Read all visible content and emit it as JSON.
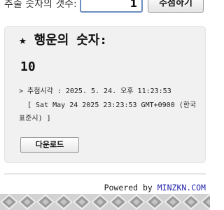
{
  "form": {
    "count_label": "추출 숫자의 갯수:",
    "count_value": "1",
    "draw_button": "추첨하기"
  },
  "result": {
    "star_icon": "star-icon",
    "title": "★ 행운의 숫자:",
    "number": "10",
    "chevron": ">",
    "draw_time": "추첨시각 : 2025. 5. 24. 오후 11:23:53",
    "draw_time_detail": "[ Sat May 24 2025 23:23:53 GMT+0900 (한국 표준시) ]",
    "download_button": "다운로드"
  },
  "footer": {
    "powered_by": "Powered by ",
    "link_text": "MINZKN.COM",
    "colors": {
      "link": "#2222aa",
      "pattern_light": "#d2d2d2",
      "pattern_dark": "#9b9b9b"
    }
  }
}
